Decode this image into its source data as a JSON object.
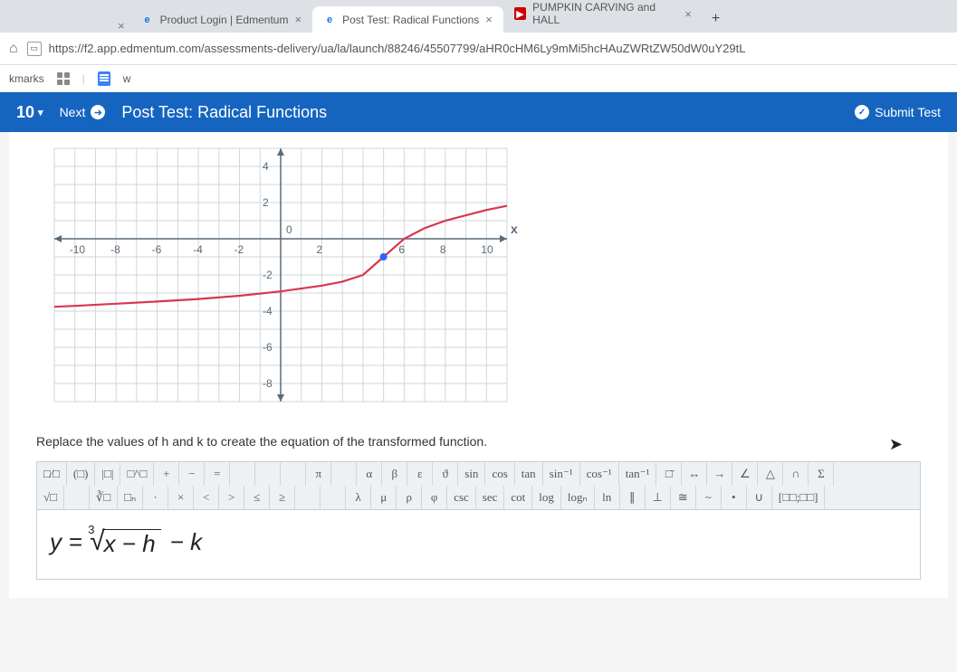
{
  "browser": {
    "tabs": [
      {
        "label": "Product Login | Edmentum",
        "favicon": "e"
      },
      {
        "label": "Post Test: Radical Functions",
        "favicon": "e",
        "active": true
      },
      {
        "label": "PUMPKIN CARVING and HALL",
        "favicon": "yt"
      }
    ],
    "url": "https://f2.app.edmentum.com/assessments-delivery/ua/la/launch/88246/45507799/aHR0cHM6Ly9mMi5hcHAuZWRtZW50dW0uY29tL",
    "bookmarks_label": "kmarks",
    "bookmark_item": "w"
  },
  "test": {
    "question_number": "10",
    "next_label": "Next",
    "title": "Post Test: Radical Functions",
    "submit_label": "Submit Test"
  },
  "chart_data": {
    "type": "line",
    "title": "",
    "xlabel": "x",
    "ylabel": "",
    "xlim": [
      -11,
      11
    ],
    "ylim": [
      -9,
      5
    ],
    "x_ticks": [
      -10,
      -8,
      -6,
      -4,
      -2,
      2,
      6,
      8,
      10
    ],
    "y_ticks": [
      4,
      2,
      -2,
      -4,
      -6,
      -8
    ],
    "origin_label": "0",
    "series": [
      {
        "name": "curve",
        "color": "#d9364f",
        "x": [
          -11,
          -10,
          -8,
          -6,
          -4,
          -2,
          0,
          2,
          3,
          4,
          5,
          6,
          7,
          8,
          10,
          11
        ],
        "y": [
          -3.76,
          -3.71,
          -3.59,
          -3.47,
          -3.33,
          -3.15,
          -2.91,
          -2.59,
          -2.37,
          -2.0,
          -1.0,
          0,
          0.59,
          1.0,
          1.59,
          1.82
        ]
      }
    ],
    "marker_point": {
      "x": 5,
      "y": -1
    }
  },
  "prompt": "Replace the values of h and k to create the equation of the transformed function.",
  "toolbar": {
    "r1": [
      "□⁄□",
      "(□)",
      "|□|",
      "□^□",
      "+",
      "−",
      "=",
      "",
      "",
      "",
      "π",
      "",
      "α",
      "β",
      "ε",
      "ϑ",
      "sin",
      "cos",
      "tan",
      "sin⁻¹",
      "cos⁻¹",
      "tan⁻¹",
      "□̄",
      "↔",
      "→",
      "∠",
      "△",
      "∩",
      "Σ"
    ],
    "r2": [
      "√□",
      "",
      "∛□",
      "□ₙ",
      "·",
      "×",
      "<",
      ">",
      "≤",
      "≥",
      "",
      "",
      "λ",
      "μ",
      "ρ",
      "φ",
      "csc",
      "sec",
      "cot",
      "log",
      "logₙ",
      "ln",
      "∥",
      "⊥",
      "≅",
      "~",
      "•",
      "∪",
      "[□□;□□]"
    ]
  },
  "equation": {
    "lhs": "y",
    "equals": "=",
    "root_index": "3",
    "radicand": "x − h",
    "tail": "− k"
  }
}
